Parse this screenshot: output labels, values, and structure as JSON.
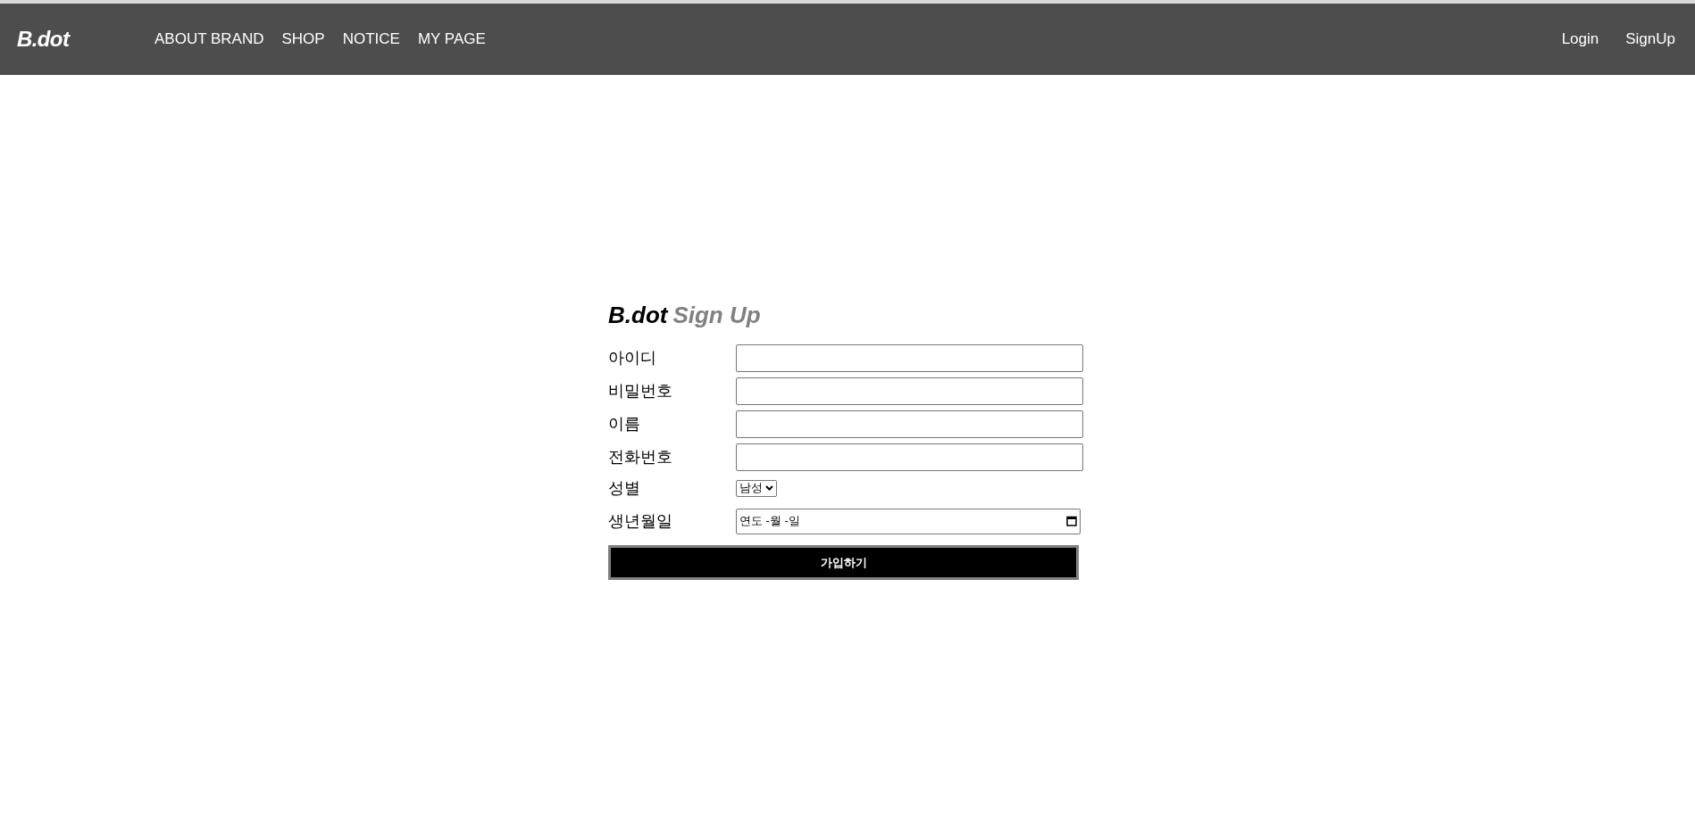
{
  "header": {
    "logo": "B.dot",
    "nav": [
      "ABOUT BRAND",
      "SHOP",
      "NOTICE",
      "MY PAGE"
    ],
    "auth_links": [
      "Login",
      "SignUp"
    ]
  },
  "form": {
    "title": {
      "brand": "B.dot",
      "text": "Sign Up"
    },
    "fields": [
      {
        "kind": "text",
        "label": "아이디"
      },
      {
        "kind": "text",
        "label": "비밀번호"
      },
      {
        "kind": "text",
        "label": "이름"
      },
      {
        "kind": "text",
        "label": "전화번호"
      },
      {
        "kind": "select",
        "label": "성별",
        "value": "남성"
      },
      {
        "kind": "date",
        "label": "생년월일",
        "value": "연도 -월 -일"
      }
    ],
    "submit": "가입하기"
  }
}
